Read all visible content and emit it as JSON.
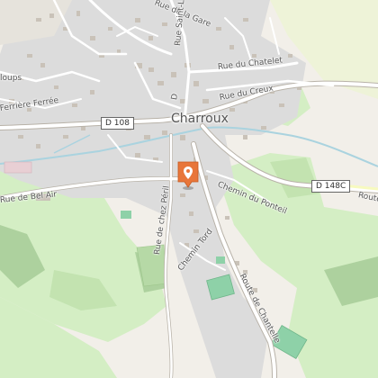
{
  "map": {
    "town_name": "Charroux",
    "road_shields": [
      "D 108",
      "D 148C"
    ],
    "street_labels": [
      "Rue de la Gare",
      "Rue Saint-L",
      "Rue du Chatelet",
      "Rue du Creux",
      "Chemin du Ponteil",
      "Route",
      "Rue de chez Péril",
      "Chemin Tord",
      "Route de Chantelle",
      "Rue de Bel Air",
      "Ferrière Ferrée",
      "loups",
      "D"
    ],
    "marker": {
      "icon": "map-pin-icon",
      "color": "#e8763a"
    },
    "colors": {
      "background": "#f2efe9",
      "built_area": "#dcdcdc",
      "buildings": "#c9c2b8",
      "meadow": "#d4eec4",
      "forest": "#add19e",
      "sports": "#8ed1a8",
      "water": "#aad3df",
      "road": "#ffffff",
      "road_casing": "#b8b2a8",
      "secondary_road": "#f7fabf"
    }
  }
}
